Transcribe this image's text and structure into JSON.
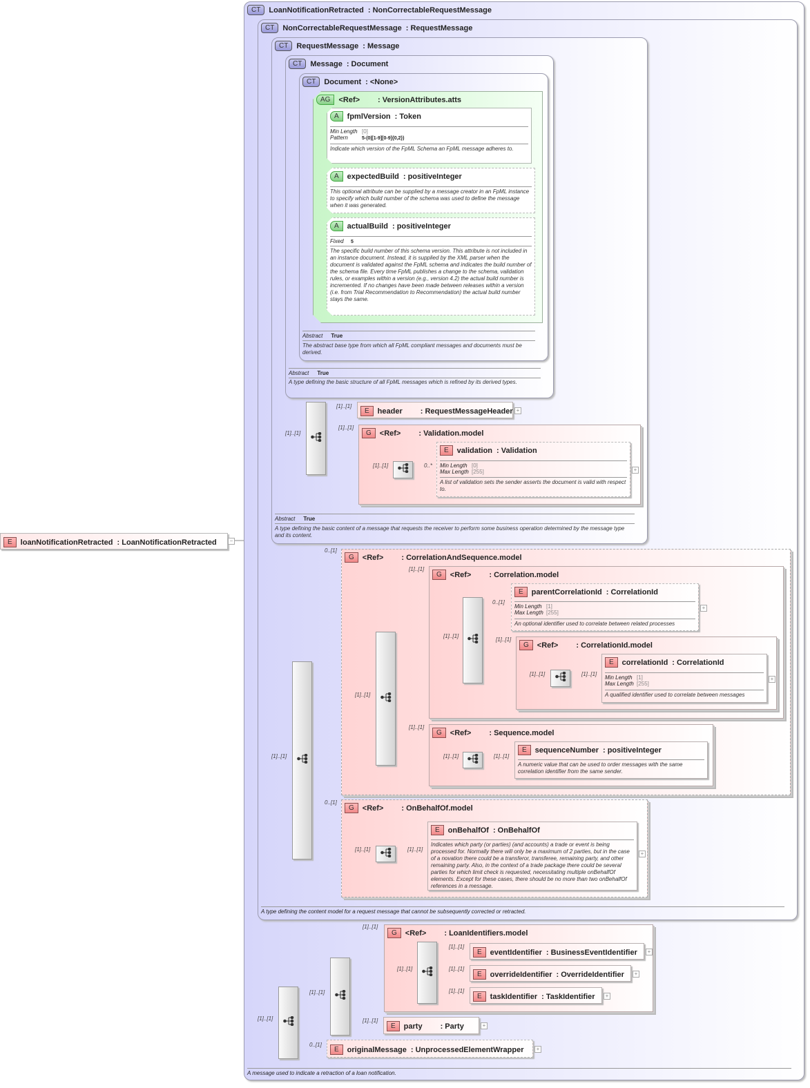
{
  "root": {
    "badge": "E",
    "name": "loanNotificationRetracted",
    "type": ": LoanNotificationRetracted",
    "toggle": "−"
  },
  "types": {
    "loanNotificationRetracted": {
      "badge": "CT",
      "name": "LoanNotificationRetracted",
      "type": ": NonCorrectableRequestMessage",
      "description": "A message used to indicate a retraction of a loan notification."
    },
    "nonCorrectable": {
      "badge": "CT",
      "name": "NonCorrectableRequestMessage",
      "type": ": RequestMessage",
      "description": "A type defining the content model for a request message that cannot be subsequently corrected or retracted."
    },
    "requestMessage": {
      "badge": "CT",
      "name": "RequestMessage",
      "type": ": Message",
      "abstract_label": "Abstract",
      "abstract_value": "True",
      "description": "A type defining the basic content of a message that requests the receiver to perform some business operation determined by the message type and its content."
    },
    "message": {
      "badge": "CT",
      "name": "Message",
      "type": ": Document",
      "abstract_label": "Abstract",
      "abstract_value": "True",
      "description": "A type defining the basic structure of all FpML messages which is refined by its derived types."
    },
    "document": {
      "badge": "CT",
      "name": "Document",
      "type": ": <None>",
      "abstract_label": "Abstract",
      "abstract_value": "True",
      "description": "The abstract base type from which all FpML compliant messages and documents must be derived."
    }
  },
  "versionAttributes": {
    "badge": "AG",
    "ref": "<Ref>",
    "type": ": VersionAttributes.atts",
    "fpmlVersion": {
      "badge": "A",
      "name": "fpmlVersion",
      "type": ": Token",
      "min_label": "Min Length",
      "min_value": "[0]",
      "pattern_label": "Pattern",
      "pattern_value": "5-(0|[1-9][0-9]{0,2})",
      "description": "Indicate which version of the FpML Schema an FpML message adheres to."
    },
    "expectedBuild": {
      "badge": "A",
      "name": "expectedBuild",
      "type": ": positiveInteger",
      "description": "This optional attribute can be supplied by a message creator in an FpML instance to specify which build number of the schema was used to define the message when it was generated."
    },
    "actualBuild": {
      "badge": "A",
      "name": "actualBuild",
      "type": ": positiveInteger",
      "fixed_label": "Fixed",
      "fixed_value": "5",
      "description": "The specific build number of this schema version. This attribute is not included in an instance document. Instead, it is supplied by the XML parser when the document is validated against the FpML schema and indicates the build number of the schema file. Every time FpML publishes a change to the schema, validation rules, or examples within a version (e.g., version 4.2) the actual build number is incremented. If no changes have been made between releases within a version (i.e. from Trial Recommendation to Recommendation) the actual build number stays the same."
    }
  },
  "header": {
    "badge": "E",
    "name": "header",
    "type": ": RequestMessageHeader",
    "card": "[1]..[1]"
  },
  "validationModel": {
    "badge": "G",
    "ref": "<Ref>",
    "type": ": Validation.model",
    "card": "[1]..[1]",
    "seq_card": "[1]..[1]",
    "validation": {
      "badge": "E",
      "name": "validation",
      "type": ": Validation",
      "card": "0..*",
      "min_label": "Min Length",
      "min_value": "[0]",
      "max_label": "Max Length",
      "max_value": "[255]",
      "description": "A list of validation sets the sender asserts the document is valid with respect to."
    }
  },
  "seq1_card": "[1]..[1]",
  "seq2_card": "[1]..[1]",
  "correlationAndSequence": {
    "badge": "G",
    "ref": "<Ref>",
    "type": ": CorrelationAndSequence.model",
    "card": "0..[1]",
    "seq_card": "[1]..[1]"
  },
  "correlationModel": {
    "badge": "G",
    "ref": "<Ref>",
    "type": ": Correlation.model",
    "card": "[1]..[1]",
    "seq_card": "[1]..[1]",
    "parentCorrelationId": {
      "badge": "E",
      "name": "parentCorrelationId",
      "type": ": CorrelationId",
      "card": "0..[1]",
      "min_label": "Min Length",
      "min_value": "[1]",
      "max_label": "Max Length",
      "max_value": "[255]",
      "description": "An optional identifier used to correlate between related processes"
    }
  },
  "correlationIdModel": {
    "badge": "G",
    "ref": "<Ref>",
    "type": ": CorrelationId.model",
    "card": "[1]..[1]",
    "seq_card": "[1]..[1]",
    "correlationId": {
      "badge": "E",
      "name": "correlationId",
      "type": ": CorrelationId",
      "card": "[1]..[1]",
      "min_label": "Min Length",
      "min_value": "[1]",
      "max_label": "Max Length",
      "max_value": "[255]",
      "description": "A qualified identifier used to correlate between messages"
    }
  },
  "sequenceModel": {
    "badge": "G",
    "ref": "<Ref>",
    "type": ": Sequence.model",
    "card": "[1]..[1]",
    "seq_card": "[1]..[1]",
    "sequenceNumber": {
      "badge": "E",
      "name": "sequenceNumber",
      "type": ": positiveInteger",
      "card": "[1]..[1]",
      "description": "A numeric value that can be used to order messages with the same correlation identifier from the same sender."
    }
  },
  "onBehalfOfModel": {
    "badge": "G",
    "ref": "<Ref>",
    "type": ": OnBehalfOf.model",
    "card": "0..[1]",
    "seq_card": "[1]..[1]",
    "onBehalfOf": {
      "badge": "E",
      "name": "onBehalfOf",
      "type": ": OnBehalfOf",
      "card": "[1]..[1]",
      "description": "Indicates which party (or parties) (and accounts) a trade or event is being processed for. Normally there will only be a maximum of 2 parties, but in the case of a novation there could be a transferor, transferee, remaining party, and other remaining party. Also, in the context of a trade package there could be several parties for which limit check is requested, necessitating multiple onBehalfOf elements. Except for these cases, there should be no more than two onBehalfOf references in a message."
    }
  },
  "seq3_card": "[1]..[1]",
  "seq4_card": "[1]..[1]",
  "loanIdentifiersModel": {
    "badge": "G",
    "ref": "<Ref>",
    "type": ": LoanIdentifiers.model",
    "card": "[1]..[1]",
    "choice_card": "[1]..[1]",
    "items": [
      {
        "badge": "E",
        "name": "eventIdentifier",
        "type": ": BusinessEventIdentifier",
        "card": "[1]..[1]"
      },
      {
        "badge": "E",
        "name": "overrideIdentifier",
        "type": ": OverrideIdentifier",
        "card": "[1]..[1]"
      },
      {
        "badge": "E",
        "name": "taskIdentifier",
        "type": ": TaskIdentifier",
        "card": "[1]..[1]"
      }
    ]
  },
  "party": {
    "badge": "E",
    "name": "party",
    "type": ": Party",
    "card": "[1]..[1]"
  },
  "originalMessage": {
    "badge": "E",
    "name": "originalMessage",
    "type": ": UnprocessedElementWrapper",
    "card": "0..[1]"
  },
  "expand_glyph": "+"
}
